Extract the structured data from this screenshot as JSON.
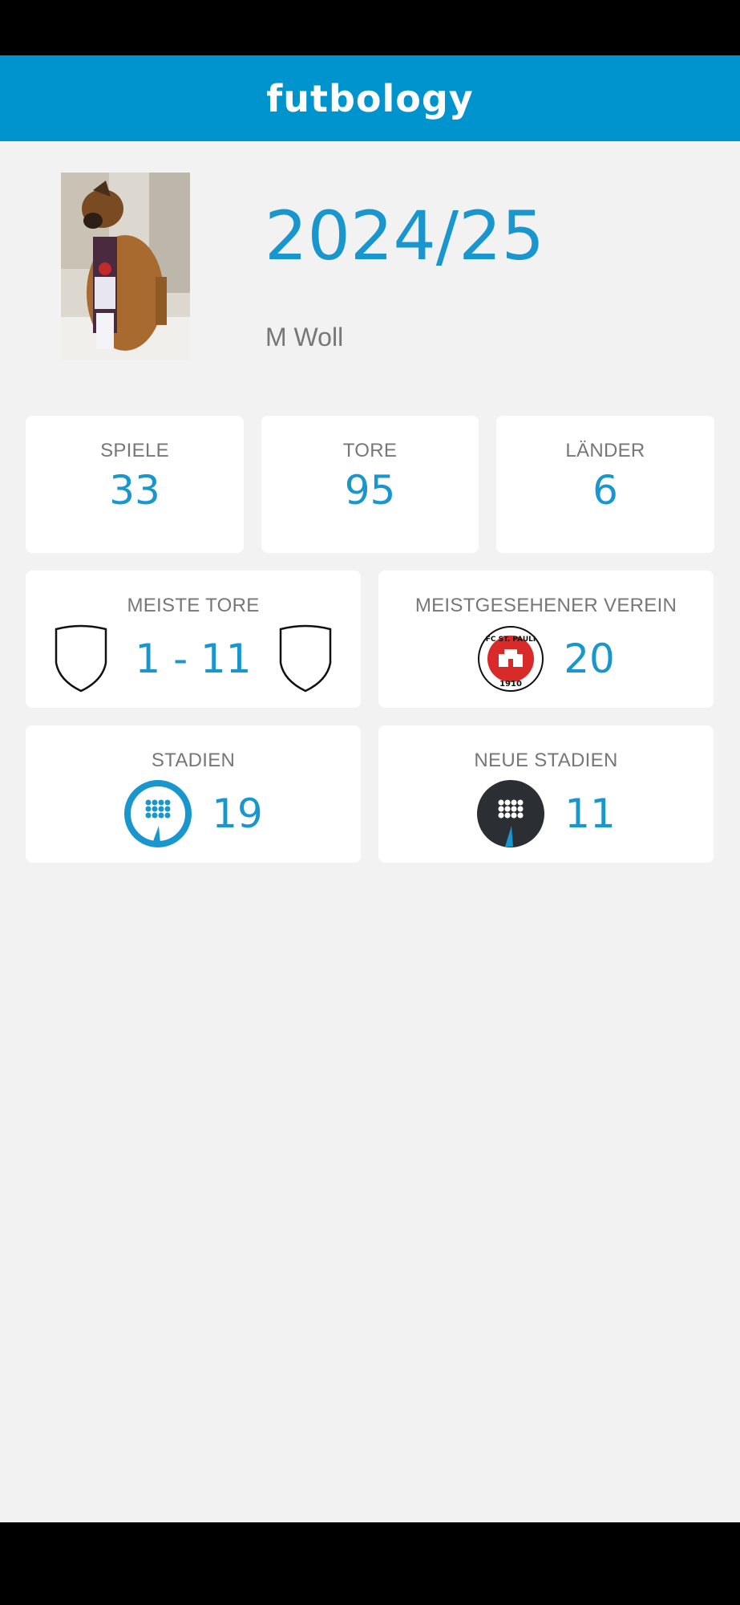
{
  "app": {
    "logo_text": "futbology"
  },
  "profile": {
    "season": "2024/25",
    "user_name": "M Woll"
  },
  "stats": {
    "games": {
      "label": "SPIELE",
      "value": "33"
    },
    "goals": {
      "label": "TORE",
      "value": "95"
    },
    "countries": {
      "label": "LÄNDER",
      "value": "6"
    }
  },
  "most_goals": {
    "label": "MEISTE TORE",
    "score": "1 - 11"
  },
  "most_seen_club": {
    "label": "MEISTGESEHENER VEREIN",
    "value": "20",
    "badge_top_text": "FC ST. PAULI",
    "badge_year": "1910"
  },
  "stadiums": {
    "label": "STADIEN",
    "value": "19"
  },
  "new_stadiums": {
    "label": "NEUE STADIEN",
    "value": "11"
  },
  "colors": {
    "accent": "#0094cf",
    "value_blue": "#1a96cf",
    "dark_icon": "#2b2f33"
  }
}
